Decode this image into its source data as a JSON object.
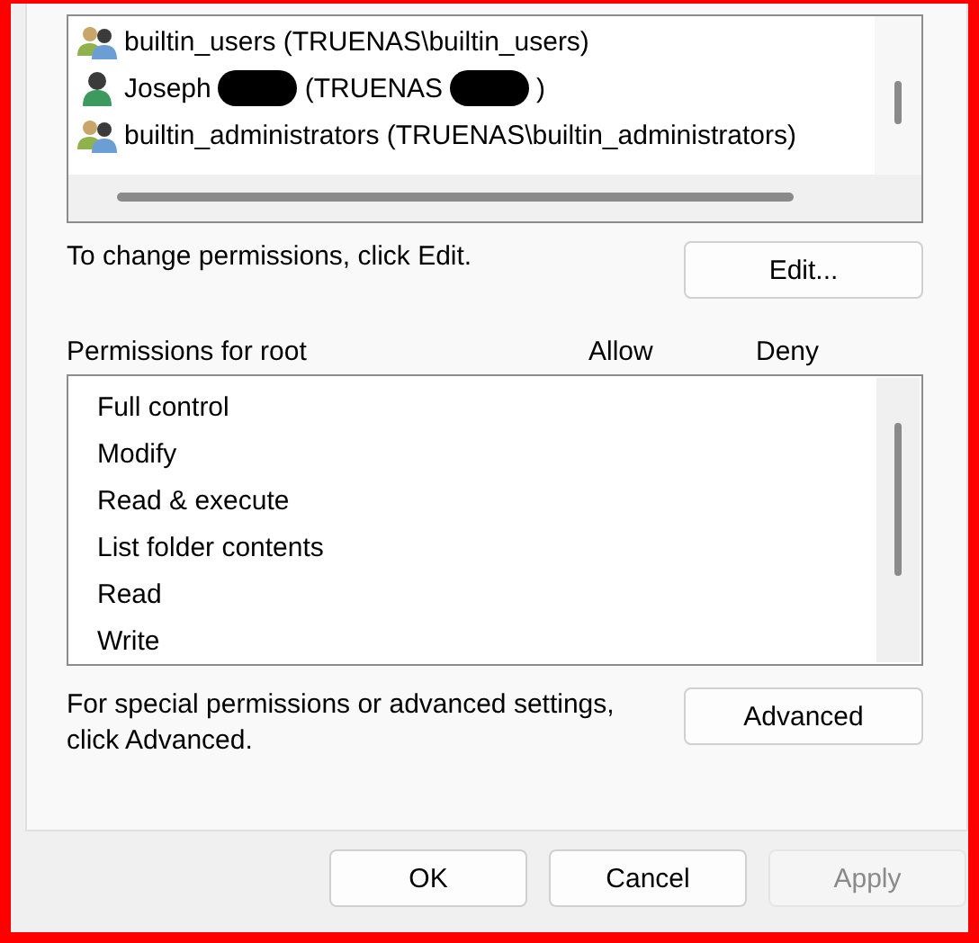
{
  "principals": [
    {
      "kind": "group",
      "segments": [
        {
          "kind": "text",
          "text": "builtin_users (TRUENAS\\builtin_users)"
        }
      ]
    },
    {
      "kind": "user",
      "segments": [
        {
          "kind": "text",
          "text": "Joseph"
        },
        {
          "kind": "redaction"
        },
        {
          "kind": "text",
          "text": "(TRUENAS"
        },
        {
          "kind": "redaction"
        },
        {
          "kind": "text",
          "text": ")"
        }
      ]
    },
    {
      "kind": "group",
      "segments": [
        {
          "kind": "text",
          "text": "builtin_administrators (TRUENAS\\builtin_administrators)"
        }
      ]
    }
  ],
  "change_hint": "To change permissions, click Edit.",
  "edit_button": "Edit...",
  "permissions": {
    "title": "Permissions for root",
    "columns": [
      "Allow",
      "Deny"
    ],
    "rows": [
      "Full control",
      "Modify",
      "Read & execute",
      "List folder contents",
      "Read",
      "Write"
    ]
  },
  "advanced_hint": "For special permissions or advanced settings, click Advanced.",
  "advanced_button": "Advanced",
  "buttons": [
    {
      "label": "OK",
      "disabled": false
    },
    {
      "label": "Cancel",
      "disabled": false
    },
    {
      "label": "Apply",
      "disabled": true
    }
  ]
}
